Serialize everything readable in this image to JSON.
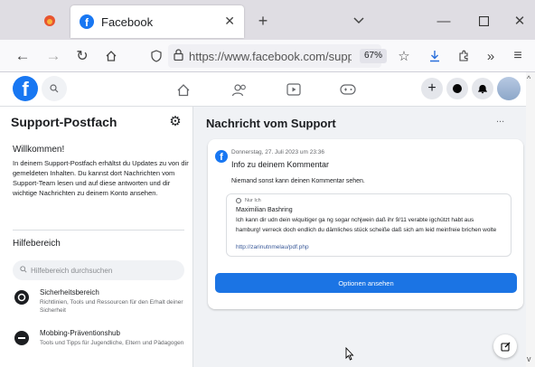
{
  "browser": {
    "tab_title": "Facebook",
    "url": "https://www.facebook.com/suppo",
    "zoom": "67%"
  },
  "sidebar": {
    "title": "Support-Postfach",
    "welcome_heading": "Willkommen!",
    "welcome_text": "In deinem Support-Postfach erhältst du Updates zu von dir gemeldeten Inhalten. Du kannst dort Nachrichten vom Support-Team lesen und auf diese antworten und dir wichtige Nachrichten zu deinem Konto ansehen.",
    "help_heading": "Hilfebereich",
    "search_placeholder": "Hilfebereich durchsuchen",
    "items": [
      {
        "title": "Sicherheitsbereich",
        "desc": "Richtlinien, Tools und Ressourcen für den Erhalt deiner Sicherheit"
      },
      {
        "title": "Mobbing-Präventionshub",
        "desc": "Tools und Tipps für Jugendliche, Eltern und Pädagogen"
      }
    ]
  },
  "main": {
    "title": "Nachricht vom Support",
    "more": "...",
    "message": {
      "timestamp": "Donnerstag, 27. Juli 2023 um 23:36",
      "heading": "Info zu deinem Kommentar",
      "subtext": "Niemand sonst kann deinen Kommentar sehen.",
      "quote_meta": "Nur Ich",
      "quote_author": "Maximilian Bashring",
      "quote_text": "Ich kann dir udn dein wiquitiger ga ng sogar nchjwein daß ihr 9/11 verabte igchützt habt aus hamburg! verreck doch endlich du dämliches stück scheiße daß sich am leid meinfreie brichen wolte",
      "quote_link": "http://zarinutnmelau/pdf.php",
      "button_label": "Optionen ansehen"
    }
  },
  "colors": {
    "fb_blue": "#1877f2",
    "button_blue": "#1b74e4"
  }
}
